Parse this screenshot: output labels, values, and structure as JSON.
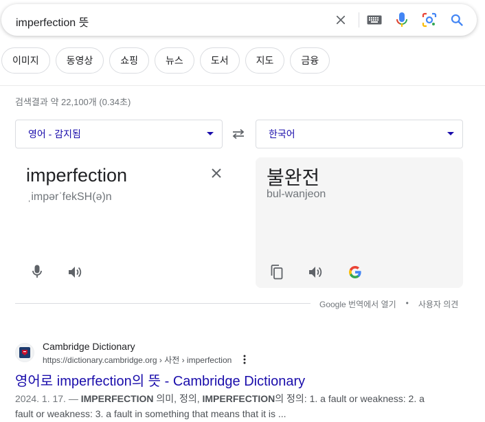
{
  "search": {
    "query": "imperfection 뜻"
  },
  "chips": [
    "이미지",
    "동영상",
    "쇼핑",
    "뉴스",
    "도서",
    "지도",
    "금융"
  ],
  "result_stats": "검색결과 약 22,100개 (0.34초)",
  "translate": {
    "source_lang": "영어 - 감지됨",
    "target_lang": "한국어",
    "source_word": "imperfection",
    "source_phonetic": "ˌimpərˈfekSH(ə)n",
    "target_word": "불완전",
    "target_romanization": "bul-wanjeon",
    "footer_open": "Google 번역에서 열기",
    "footer_sep": "•",
    "footer_feedback": "사용자 의견"
  },
  "result": {
    "site_name": "Cambridge Dictionary",
    "url": "https://dictionary.cambridge.org › 사전 › imperfection",
    "title": "영어로 imperfection의 뜻 - Cambridge Dictionary",
    "snippet_date": "2024. 1. 17. —",
    "snippet_parts": {
      "p1_bold": "IMPERFECTION",
      "p2": " 의미, 정의, ",
      "p3_bold": "IMPERFECTION",
      "p4": "의 정의: 1. a fault or weakness: 2. a fault or weakness: 3. a fault in something that means that it is ..."
    }
  },
  "colors": {
    "link": "#1a0dab",
    "mic_blue": "#4285f4",
    "mic_red": "#ea4335",
    "muted": "#70757a"
  }
}
